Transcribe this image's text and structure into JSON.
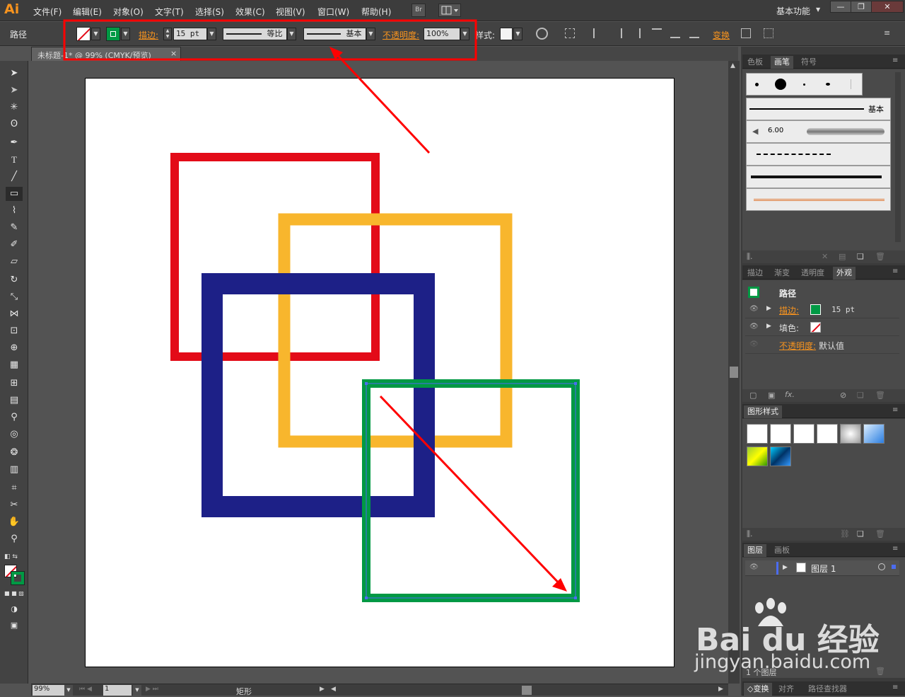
{
  "app": {
    "logo": "Ai",
    "workspace": "基本功能"
  },
  "menu": [
    "文件(F)",
    "编辑(E)",
    "对象(O)",
    "文字(T)",
    "选择(S)",
    "效果(C)",
    "视图(V)",
    "窗口(W)",
    "帮助(H)"
  ],
  "menubar_buttons": {
    "bridge": "Br"
  },
  "control": {
    "selection_label": "路径",
    "stroke_label": "描边:",
    "stroke_value": "15 pt",
    "profile_label": "等比",
    "brush_label": "基本",
    "opacity_label": "不透明度:",
    "opacity_value": "100%",
    "style_label": "样式:",
    "transform_label": "变换"
  },
  "document": {
    "tab_title": "未标题-1* @ 99% (CMYK/预览)",
    "close": "×"
  },
  "status": {
    "zoom": "99%",
    "artboard_index": "1",
    "mode": "矩形"
  },
  "brush_panel": {
    "tabs": [
      "色板",
      "画笔",
      "符号"
    ],
    "active_tab": "画笔",
    "basic_label": "基本",
    "size_label": "6.00"
  },
  "appearance_panel": {
    "tabs": [
      "描边",
      "渐变",
      "透明度",
      "外观"
    ],
    "active_tab": "外观",
    "title": "路径",
    "stroke_label": "描边:",
    "stroke_value": "15 pt",
    "fill_label": "填色:",
    "opacity_label": "不透明度:",
    "opacity_value": "默认值",
    "fx": "fx."
  },
  "graphic_styles_panel": {
    "title": "图形样式"
  },
  "layers_panel": {
    "tabs": [
      "图层",
      "画板"
    ],
    "active_tab": "图层",
    "layer_name": "图层 1",
    "layer_count": "1 个图层"
  },
  "bottom_tabs": [
    "◇变换",
    "对齐",
    "路径查找器"
  ],
  "watermark": {
    "brand": "Bai du 经验",
    "url": "jingyan.baidu.com"
  },
  "colors": {
    "red_square": "#e30b18",
    "yellow_square": "#f8b62d",
    "navy_square": "#1d2087",
    "green_square": "#009944",
    "annotation": "#ff0000",
    "accent_orange": "#f7931e"
  }
}
